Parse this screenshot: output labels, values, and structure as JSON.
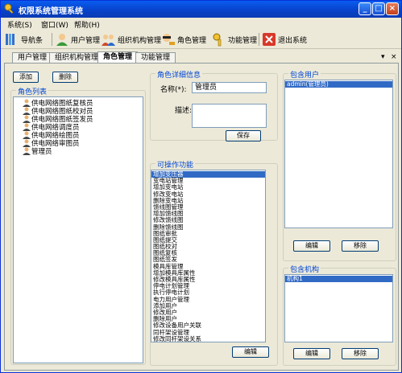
{
  "window": {
    "title": "权限系统管理系统",
    "controls": [
      "minimize",
      "maximize",
      "close"
    ]
  },
  "menu": [
    "系统(S)",
    "窗口(W)",
    "帮助(H)"
  ],
  "toolbar": {
    "items": [
      {
        "label": "导航条",
        "icon": "navigation-icon"
      },
      {
        "label": "用户管理",
        "icon": "user-icon"
      },
      {
        "label": "组织机构管理",
        "icon": "organization-icon"
      },
      {
        "label": "角色管理",
        "icon": "role-icon"
      },
      {
        "label": "功能管理",
        "icon": "key-icon"
      },
      {
        "label": "退出系统",
        "icon": "exit-icon"
      }
    ]
  },
  "tabs": [
    {
      "label": "用户管理",
      "active": false
    },
    {
      "label": "组织机构管理",
      "active": false
    },
    {
      "label": "角色管理",
      "active": true
    },
    {
      "label": "功能管理",
      "active": false
    }
  ],
  "role_panel": {
    "add_label": "添加",
    "delete_label": "删除",
    "list_title": "角色列表",
    "roles": [
      "供电网络图纸复核员",
      "供电网络图纸校对员",
      "供电网络图纸签发员",
      "供电网络调度员",
      "供电网络绘图员",
      "供电网络审图员",
      "管理员"
    ]
  },
  "detail": {
    "title": "角色详细信息",
    "name_label": "名称(*):",
    "name_value": "管理员",
    "desc_label": "描述:",
    "desc_value": "",
    "save_label": "保存"
  },
  "functions": {
    "title": "可操作功能",
    "items": [
      "增加变压器",
      "变电站管理",
      "增加变电站",
      "修改变电站",
      "删除变电站",
      "馈线图管理",
      "增加馈线图",
      "修改馈线图",
      "删除馈线图",
      "图纸审批",
      "图纸提交",
      "图纸校对",
      "图纸复核",
      "图纸签发",
      "模具库管理",
      "增加模具库属性",
      "修改模具库属性",
      "停电计划管理",
      "执行停电计划",
      "电力用户管理",
      "添加用户",
      "修改用户",
      "删除用户",
      "修改设备用户关联",
      "同杆架设管理",
      "修改同杆架设关系"
    ],
    "selected_index": 0,
    "edit_label": "编辑"
  },
  "users": {
    "title": "包含用户",
    "items": [
      "admin(管理员)"
    ],
    "edit_label": "编辑",
    "remove_label": "移除"
  },
  "orgs": {
    "title": "包含机构",
    "items": [
      "机构1"
    ],
    "edit_label": "编辑",
    "remove_label": "移除"
  }
}
